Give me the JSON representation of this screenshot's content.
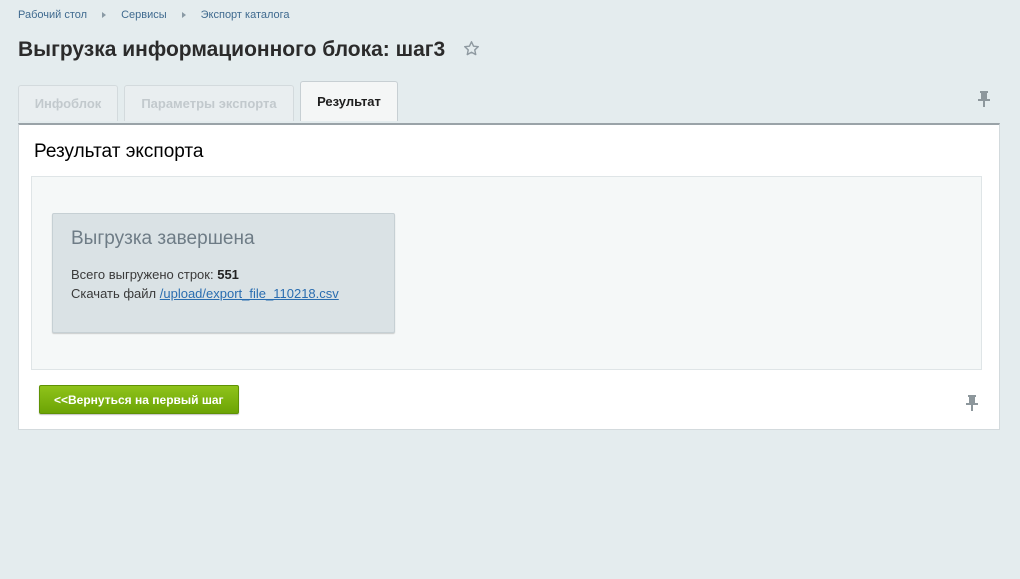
{
  "breadcrumbs": [
    {
      "label": "Рабочий стол"
    },
    {
      "label": "Сервисы"
    },
    {
      "label": "Экспорт каталога"
    }
  ],
  "page_title": "Выгрузка информационного блока: шаг3",
  "tabs": [
    {
      "label": "Инфоблок",
      "active": false
    },
    {
      "label": "Параметры экспорта",
      "active": false
    },
    {
      "label": "Результат",
      "active": true
    }
  ],
  "panel": {
    "heading": "Результат экспорта",
    "result": {
      "title": "Выгрузка завершена",
      "rows_label": "Всего выгружено строк:",
      "rows_count": "551",
      "download_label": "Скачать файл",
      "download_link": "/upload/export_file_110218.csv"
    },
    "back_button": "<<Вернуться на первый шаг"
  },
  "icons": {
    "favorite": "star-icon",
    "pin": "pin-icon"
  },
  "colors": {
    "accent_button": "#7ab40f",
    "link": "#2a6db0",
    "background": "#e4ecee"
  }
}
